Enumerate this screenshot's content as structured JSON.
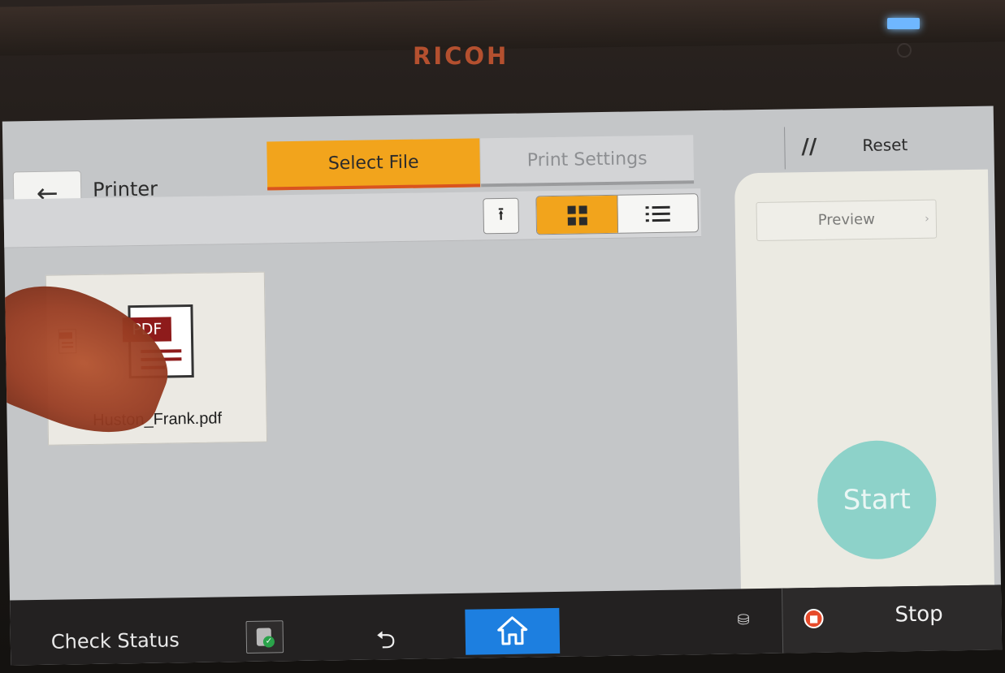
{
  "device": {
    "brand": "RICOH"
  },
  "header": {
    "back_glyph": "←",
    "app_title": "Printer",
    "tabs": [
      {
        "label": "Select File",
        "active": true
      },
      {
        "label": "Print Settings",
        "active": false
      }
    ],
    "reset_icon": "//",
    "reset_label": "Reset"
  },
  "toolbar": {
    "go_top_icon": "upload-top-icon",
    "go_top_glyph": "⭱",
    "view_modes": [
      {
        "name": "grid-view",
        "selected": true
      },
      {
        "name": "list-view",
        "selected": false
      }
    ]
  },
  "files": [
    {
      "name": "Huston_Frank.pdf",
      "type_badge": "PDF"
    }
  ],
  "side_panel": {
    "preview_label": "Preview",
    "preview_chevron": "›",
    "start_label": "Start"
  },
  "bottom_bar": {
    "check_status_label": "Check Status",
    "back_glyph": "⮌",
    "stop_label": "Stop",
    "storage_glyph": "⛁"
  },
  "colors": {
    "accent": "#f2a41c",
    "accent_underline": "#d9541f",
    "home_button": "#1d7fe0",
    "start_button": "#8dd2c9",
    "stop_icon": "#e64a2a",
    "pdf_red": "#8e1b1b"
  }
}
